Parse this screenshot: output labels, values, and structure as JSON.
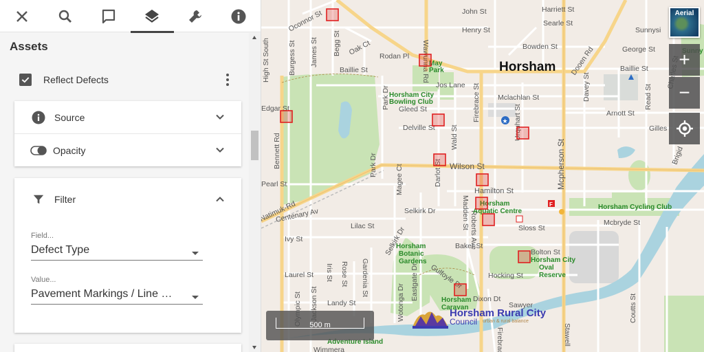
{
  "toolbar": {
    "items": [
      {
        "icon": "close-icon",
        "active": false
      },
      {
        "icon": "search-icon",
        "active": false
      },
      {
        "icon": "feedback-icon",
        "active": false
      },
      {
        "icon": "layers-icon",
        "active": true
      },
      {
        "icon": "wrench-icon",
        "active": false
      },
      {
        "icon": "info-icon",
        "active": false
      }
    ]
  },
  "panel": {
    "section_title": "Assets",
    "layer": {
      "name": "Reflect Defects",
      "checked": true
    },
    "source_label": "Source",
    "opacity_label": "Opacity",
    "filter_label": "Filter",
    "field": {
      "label": "Field...",
      "value": "Defect Type"
    },
    "value": {
      "label": "Value...",
      "value": "Pavement Markings / Line Marking"
    }
  },
  "map": {
    "town_label": "Horsham",
    "scale_label": "500 m",
    "aerial_label": "Aerial",
    "zoom_in": "+",
    "zoom_out": "−",
    "logo_line1": "Horsham Rural City",
    "logo_line2": "Council",
    "logo_tagline": "urban & rural balance",
    "colors": {
      "defect_marker": "#e02020",
      "main_road": "#f7d58a",
      "park": "#c9e3b5",
      "river": "#aad3df"
    },
    "street_labels": [
      "Oconnor St",
      "Begg St",
      "Wawunna Rd",
      "John St",
      "Harriett St",
      "Henry St",
      "Searle St",
      "Sunnysi",
      "Oak Ct",
      "Rodan Pl",
      "Bowden St",
      "Dooen Rd",
      "George St",
      "James St",
      "Burgess St",
      "High St South",
      "Baillie St",
      "Baillie St",
      "Jos Lane",
      "Mclachlan St",
      "Davey St",
      "Park Dr",
      "Gleed St",
      "Arnott St",
      "Delville St",
      "Firebrace St",
      "Urquhart St",
      "Wald St",
      "Read St",
      "Arnott St",
      "Gilles",
      "Bennett Rd",
      "Edgar St",
      "Wilson St",
      "Park Dr",
      "Darlot St",
      "Mcpherson St",
      "Hamilton St",
      "Pearl St",
      "Natimuk-Rd",
      "Magee Ct",
      "Selkirk Dr",
      "Madden St",
      "Roberts Ave",
      "Centenary Av",
      "Lilac St",
      "Selkirk Dr",
      "Sloss St",
      "Mcbryde St",
      "Ivy St",
      "Baker St",
      "Bolton St",
      "Laurel St",
      "Iris St",
      "Rose St",
      "Gardenia St",
      "Gulfoyle Dr",
      "Hocking St",
      "Landy St",
      "Eastgate Dr",
      "Wotonga Dr",
      "Dixon Dt",
      "Olympic St",
      "Jackson St",
      "Coutts St",
      "Wimmera",
      "Stawell",
      "Sawyer",
      "Charles St",
      "Brigid",
      "Firebrace St"
    ],
    "place_labels": [
      "May Park",
      "Horsham City Bowling Club",
      "Horsham Aquatic Centre",
      "Horsham Cycling Club",
      "Horsham Botanic Gardens",
      "Horsham City Oval Reserve",
      "Horsham Caravan Park",
      "Adventure Island",
      "Sunny"
    ]
  }
}
